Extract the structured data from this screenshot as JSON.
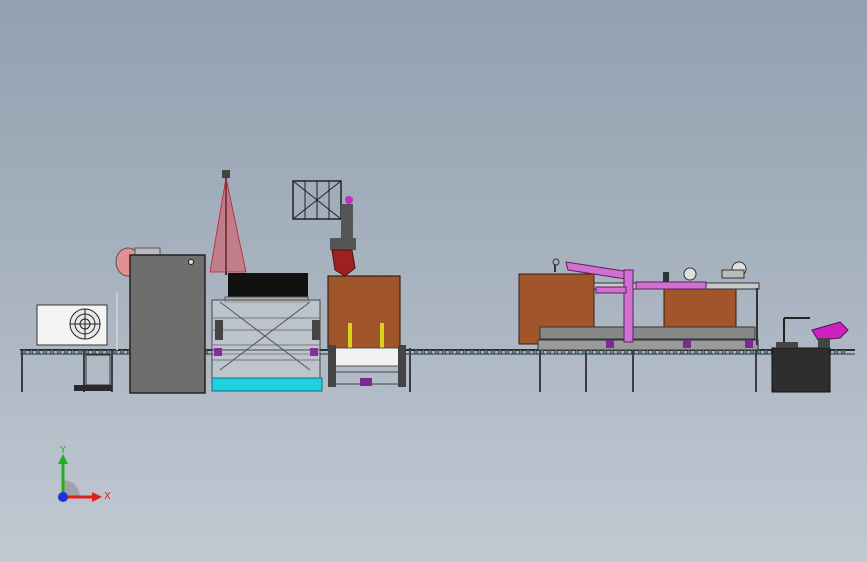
{
  "viewport": {
    "background_top": "#94a0b0",
    "background_bottom": "#c2c9d3"
  },
  "triad": {
    "x_label": "X",
    "y_label": "Y",
    "x_color": "#e02020",
    "y_color": "#20b020",
    "z_color": "#2030e0"
  },
  "colors": {
    "frame": "#555a60",
    "cabinet": "#6e6e6e",
    "wood_box": "#a0552a",
    "pink_arm": "#d070d0",
    "laser": "#e04050",
    "cyan_base": "#20d0e0",
    "black_screen": "#111111",
    "robot_red": "#a02020",
    "magenta_tool": "#d020c0"
  }
}
